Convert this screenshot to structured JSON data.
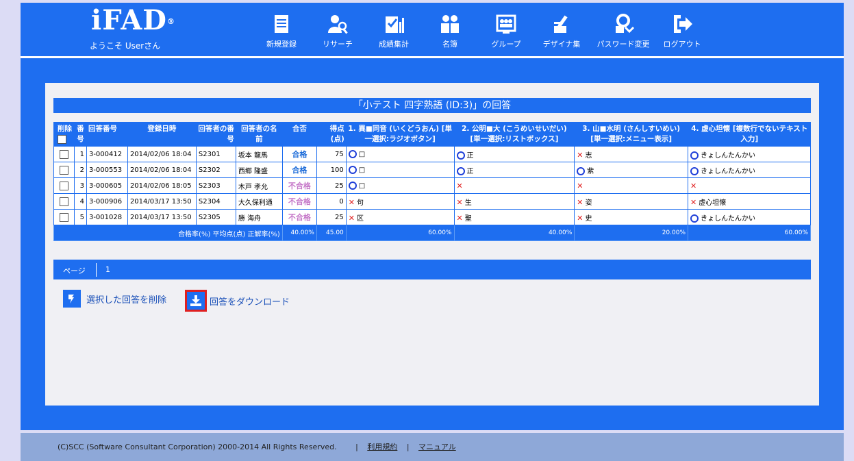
{
  "header": {
    "logo": "iFAD",
    "logo_mark": "®",
    "welcome": "ようこそ Userさん",
    "nav": [
      {
        "label": "新規登録",
        "icon": "document-icon"
      },
      {
        "label": "リサーチ",
        "icon": "research-icon"
      },
      {
        "label": "成績集計",
        "icon": "grade-summary-icon"
      },
      {
        "label": "名簿",
        "icon": "roster-icon"
      },
      {
        "label": "グループ",
        "icon": "group-icon"
      },
      {
        "label": "デザイナ集",
        "icon": "designer-icon"
      },
      {
        "label": "パスワード変更",
        "icon": "password-icon"
      },
      {
        "label": "ログアウト",
        "icon": "logout-icon"
      }
    ]
  },
  "page_title": "「小テスト 四字熟語 (ID:3)」の回答",
  "table": {
    "headers": {
      "delete": "削除",
      "no": "番号",
      "answer_no": "回答番号",
      "registered_at": "登録日時",
      "respondent_no": "回答者の番号",
      "respondent_name": "回答者の名前",
      "result": "合否",
      "score": "得点(点)",
      "q1": "1. 異■同音 (いくどうおん) [単一選択:ラジオボタン]",
      "q2": "2. 公明■大 (こうめいせいだい) [単一選択:リストボックス]",
      "q3": "3. 山■水明 (さんしすいめい) [単一選択:メニュー表示]",
      "q4": "4. 虚心坦懐 [複数行でないテキスト入力]"
    },
    "rows": [
      {
        "no": "1",
        "answer_no": "3-000412",
        "registered_at": "2014/02/06 18:04",
        "respondent_no": "S2301",
        "name": "坂本 龍馬",
        "result": "合格",
        "pass": true,
        "score": "75",
        "q1": {
          "ok": true,
          "text": "□"
        },
        "q2": {
          "ok": true,
          "text": "正"
        },
        "q3": {
          "ok": false,
          "text": "志"
        },
        "q4": {
          "ok": true,
          "text": "きょしんたんかい"
        }
      },
      {
        "no": "2",
        "answer_no": "3-000553",
        "registered_at": "2014/02/06 18:04",
        "respondent_no": "S2302",
        "name": "西郷 隆盛",
        "result": "合格",
        "pass": true,
        "score": "100",
        "q1": {
          "ok": true,
          "text": "□"
        },
        "q2": {
          "ok": true,
          "text": "正"
        },
        "q3": {
          "ok": true,
          "text": "紫"
        },
        "q4": {
          "ok": true,
          "text": "きょしんたんかい"
        }
      },
      {
        "no": "3",
        "answer_no": "3-000605",
        "registered_at": "2014/02/06 18:05",
        "respondent_no": "S2303",
        "name": "木戸 孝允",
        "result": "不合格",
        "pass": false,
        "score": "25",
        "q1": {
          "ok": true,
          "text": "□"
        },
        "q2": {
          "ok": false,
          "text": ""
        },
        "q3": {
          "ok": false,
          "text": ""
        },
        "q4": {
          "ok": false,
          "text": ""
        }
      },
      {
        "no": "4",
        "answer_no": "3-000906",
        "registered_at": "2014/03/17 13:50",
        "respondent_no": "S2304",
        "name": "大久保利通",
        "result": "不合格",
        "pass": false,
        "score": "0",
        "q1": {
          "ok": false,
          "text": "句"
        },
        "q2": {
          "ok": false,
          "text": "生"
        },
        "q3": {
          "ok": false,
          "text": "姿"
        },
        "q4": {
          "ok": false,
          "text": "虚心坦懐"
        }
      },
      {
        "no": "5",
        "answer_no": "3-001028",
        "registered_at": "2014/03/17 13:50",
        "respondent_no": "S2305",
        "name": "勝 海舟",
        "result": "不合格",
        "pass": false,
        "score": "25",
        "q1": {
          "ok": false,
          "text": "区"
        },
        "q2": {
          "ok": false,
          "text": "聖"
        },
        "q3": {
          "ok": false,
          "text": "史"
        },
        "q4": {
          "ok": true,
          "text": "きょしんたんかい"
        }
      }
    ],
    "summary": {
      "label": "合格率(%) 平均点(点) 正解率(%)",
      "pass_rate": "40.00%",
      "avg_score": "45.00",
      "q1": "60.00%",
      "q2": "40.00%",
      "q3": "20.00%",
      "q4": "60.00%"
    }
  },
  "pager": {
    "label": "ページ",
    "current": "1"
  },
  "actions": {
    "delete_label": "選択した回答を削除",
    "download_label": "回答をダウンロード"
  },
  "footer": {
    "copyright": "(C)SCC (Software Consultant Corporation) 2000-2014 All Rights Reserved.",
    "terms": "利用規約",
    "manual": "マニュアル"
  },
  "colors": {
    "primary": "#1e6ef0",
    "pass": "#1a6ad8",
    "fail": "#c576c8",
    "ng_mark": "#e02020",
    "ok_mark": "#1f3fd8"
  }
}
